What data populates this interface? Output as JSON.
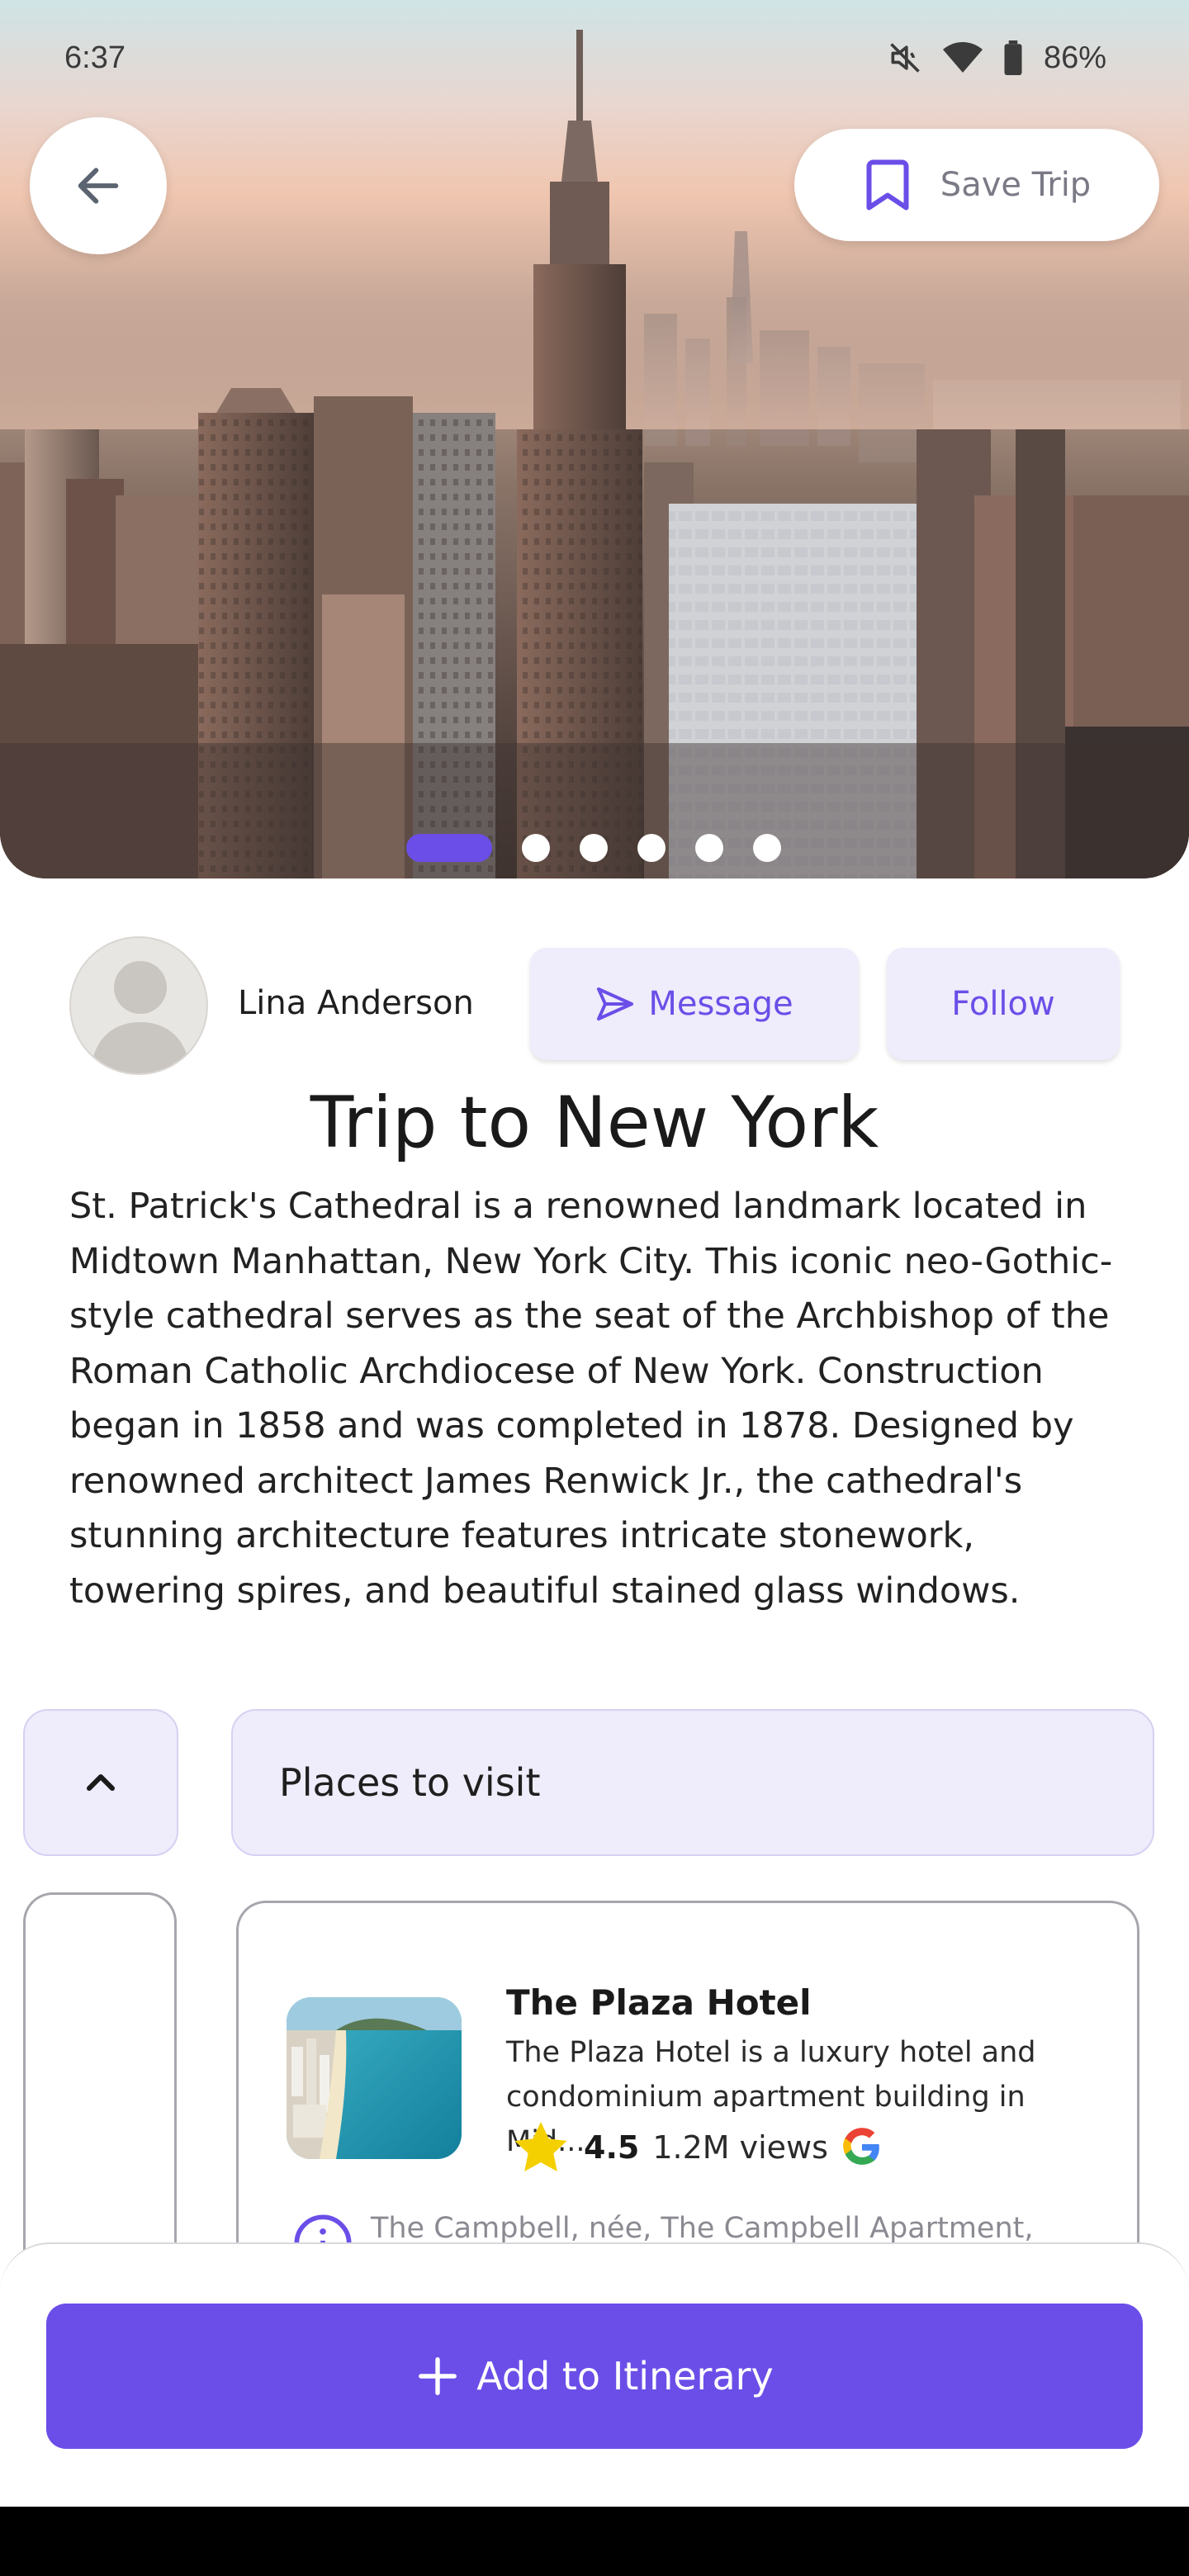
{
  "status_bar": {
    "time": "6:37",
    "battery": "86%"
  },
  "header": {
    "save_label": "Save Trip"
  },
  "carousel": {
    "slide_count": 6,
    "active_index": 0
  },
  "author": {
    "name": "Lina Anderson",
    "message_label": "Message",
    "follow_label": "Follow"
  },
  "trip": {
    "title": "Trip to New York",
    "description": "St. Patrick's Cathedral is a renowned landmark located in Midtown Manhattan, New York City. This iconic neo-Gothic-style cathedral serves as the seat of the Archbishop of the Roman Catholic Archdiocese of New York. Construction began in 1858 and was completed in 1878. Designed by renowned architect James Renwick Jr., the cathedral's stunning architecture features intricate stonework, towering spires, and beautiful stained glass windows."
  },
  "places": {
    "header_label": "Places to visit",
    "items": [
      {
        "name": "The Plaza Hotel",
        "description": "The Plaza Hotel is a luxury hotel and condominium apartment building in Mid...",
        "rating": "4.5",
        "views": "1.2M views",
        "info_text": "The Campbell, née, The Campbell Apartment,"
      }
    ]
  },
  "actions": {
    "add_label": "Add to Itinerary"
  },
  "colors": {
    "accent": "#6b4ee8",
    "accent_light": "#efecfb",
    "star": "#f5d000"
  }
}
